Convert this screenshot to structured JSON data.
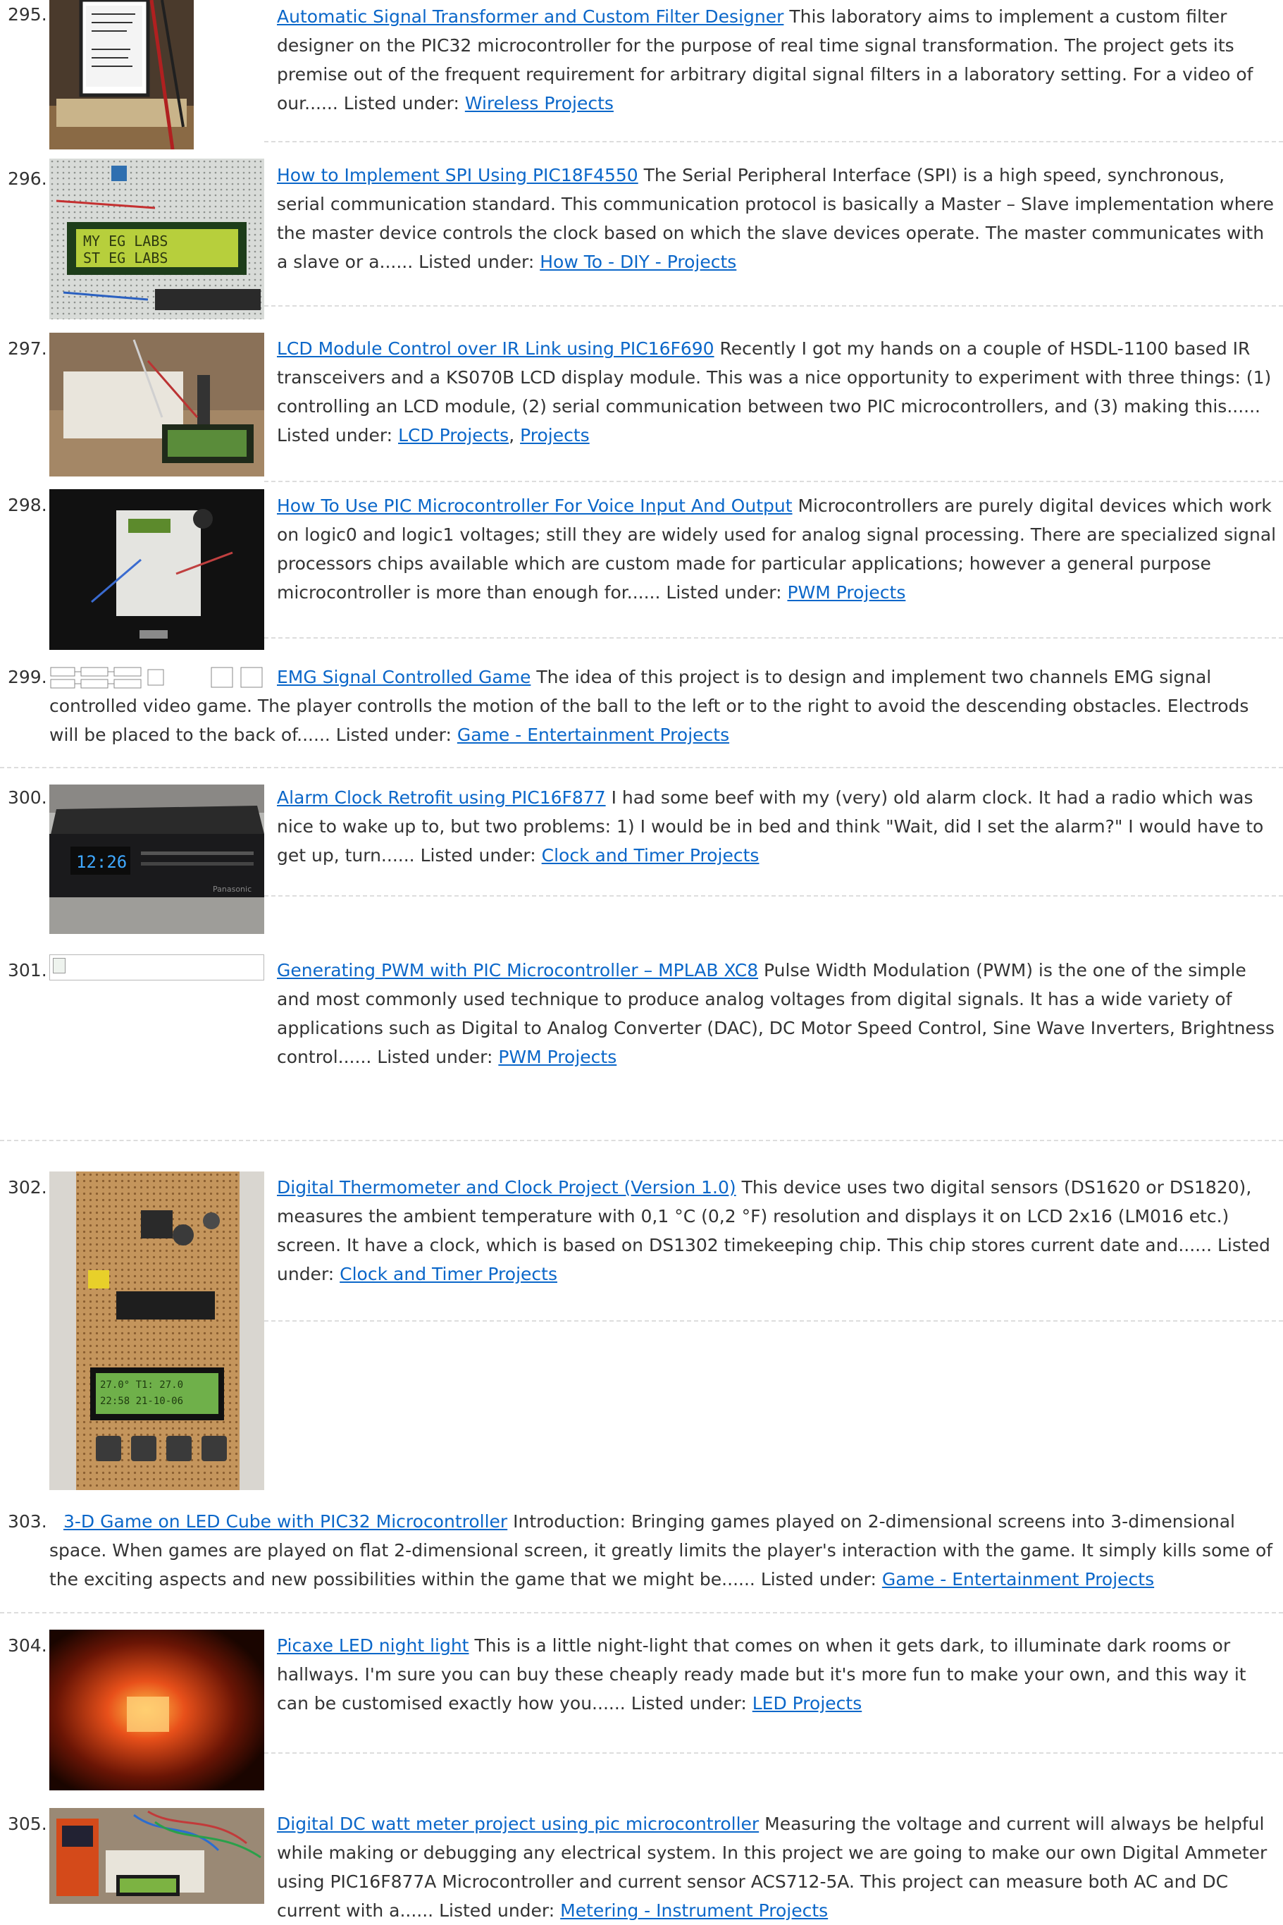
{
  "items": [
    {
      "num": "295.",
      "title": "Automatic Signal Transformer and Custom Filter Designer",
      "desc": "This laboratory aims to implement a custom filter designer on the PIC32 microcontroller for the purpose of real time signal transformation. The project gets its premise out of the frequent requirement for arbitrary digital signal filters in a laboratory setting. For a video of our......",
      "listed": "Listed under:",
      "cats": [
        "Wireless Projects"
      ]
    },
    {
      "num": "296.",
      "title": "How to Implement SPI Using PIC18F4550",
      "desc": "The Serial Peripheral Interface (SPI) is a high speed, synchronous, serial communication standard. This communication protocol is basically a Master – Slave implementation where the master device controls the clock based on which the slave devices operate. The master communicates with a slave or a......",
      "listed": "Listed under:",
      "cats": [
        "How To - DIY - Projects"
      ]
    },
    {
      "num": "297.",
      "title": "LCD Module Control over IR Link using PIC16F690",
      "desc": "Recently I got my hands on a couple of HSDL-1100 based IR transceivers and a KS070B LCD display module. This was a nice opportunity to experiment with three things: (1) controlling an LCD module, (2) serial communication between two PIC microcontrollers, and (3) making this......",
      "listed": "Listed under:",
      "cats": [
        "LCD Projects",
        "Projects"
      ]
    },
    {
      "num": "298.",
      "title": "How To Use PIC Microcontroller For Voice Input And Output",
      "desc": "Microcontrollers are purely digital devices which work on logic0 and logic1 voltages; still they are widely used for analog signal processing. There are specialized signal processors chips available which are custom made for particular applications; however a general purpose microcontroller is more than enough for......",
      "listed": "Listed under:",
      "cats": [
        "PWM Projects"
      ]
    },
    {
      "num": "299.",
      "title": "EMG Signal Controlled Game",
      "desc": "The idea of this project is to design and implement two channels EMG signal controlled video game. The player controlls the motion of the ball to the left or to the right to avoid the descending obstacles. Electrods will be placed to the back of......",
      "listed": "Listed under:",
      "cats": [
        "Game - Entertainment Projects"
      ]
    },
    {
      "num": "300.",
      "title": "Alarm Clock Retrofit using PIC16F877",
      "desc": "I had some beef with my (very) old alarm clock.  It had a radio which was nice to wake up to, but two problems: 1) I would be in bed and think \"Wait, did I set the alarm?\"  I would have to get up, turn......",
      "listed": "Listed under:",
      "cats": [
        "Clock and Timer Projects"
      ]
    },
    {
      "num": "301.",
      "title": "Generating PWM with PIC Microcontroller – MPLAB XC8",
      "desc": "Pulse Width Modulation (PWM) is the one of the simple and most commonly used technique to produce analog voltages from digital signals. It has a wide variety of applications such as Digital to Analog Converter (DAC), DC Motor Speed Control, Sine Wave Inverters, Brightness control......",
      "listed": "Listed under:",
      "cats": [
        "PWM Projects"
      ]
    },
    {
      "num": "302.",
      "title": "Digital Thermometer and Clock Project (Version 1.0)",
      "desc": "This device uses two digital sensors (DS1620 or DS1820), measures the ambient temperature with 0,1 °C (0,2 °F) resolution and displays it on LCD 2x16 (LM016 etc.) screen. It have a clock, which is based on DS1302 timekeeping chip. This chip stores current date and......",
      "listed": "Listed under:",
      "cats": [
        "Clock and Timer Projects"
      ]
    },
    {
      "num": "303.",
      "title": "3-D Game on LED Cube with PIC32 Microcontroller",
      "desc": "Introduction: Bringing games played on 2-dimensional screens into 3-dimensional space. When games are played on flat 2-dimensional screen, it greatly limits the player's interaction with the game. It simply kills some of the exciting aspects and new possibilities within the game that we might be......",
      "listed": "Listed under:",
      "cats": [
        "Game - Entertainment Projects"
      ]
    },
    {
      "num": "304.",
      "title": "Picaxe LED night light",
      "desc": "This is a little night-light that comes on when it gets dark, to illuminate dark rooms or hallways. I'm sure you can buy these cheaply ready made but it's more fun to make your own, and this way it can be customised exactly how you......",
      "listed": "Listed under:",
      "cats": [
        "LED Projects"
      ]
    },
    {
      "num": "305.",
      "title": "Digital DC watt meter project using pic microcontroller",
      "desc": "Measuring the voltage and current will always be helpful while making or debugging any electrical system. In this project we are going to make our own Digital Ammeter using PIC16F877A Microcontroller and current sensor ACS712-5A. This project can measure both AC and DC current with a......",
      "listed": "Listed under:",
      "cats": [
        "Metering - Instrument Projects"
      ]
    }
  ],
  "thumb_text": {
    "lcd296_line1": "MY EG LABS",
    "lcd296_line2": "ST EG LABS",
    "lcd300_time": "12:26",
    "lcd302_line1": "27.0° T1: 27.0",
    "lcd302_line2": "22:58  21-10-06",
    "brand300": "Panasonic"
  }
}
